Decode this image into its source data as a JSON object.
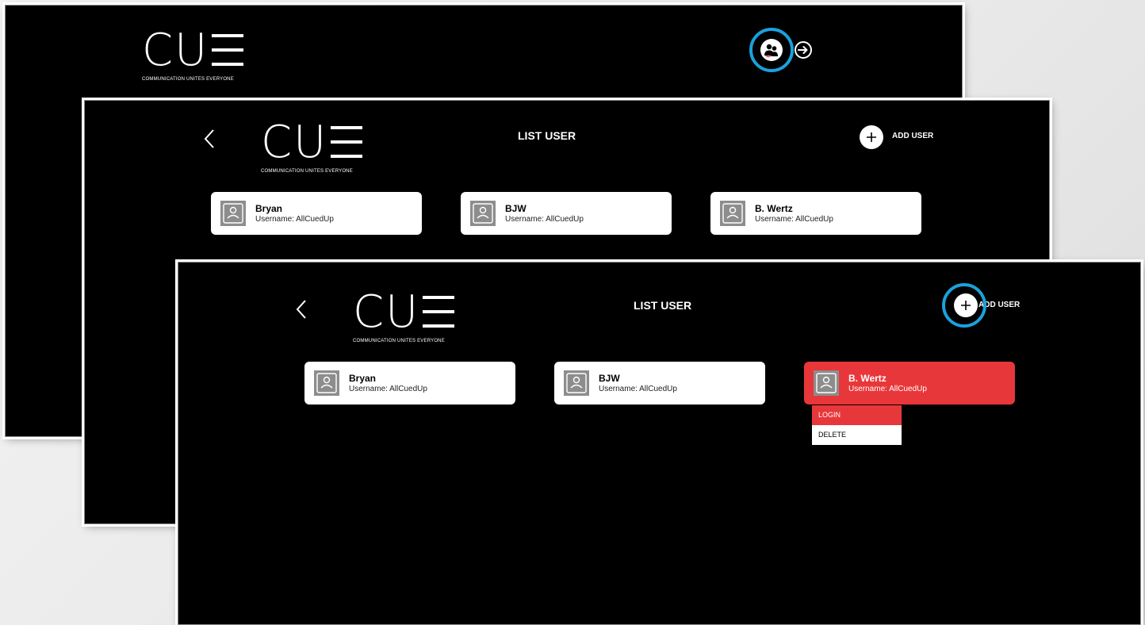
{
  "brand": {
    "logo_text": "CU",
    "tagline": "COMMUNICATION UNITES EVERYONE"
  },
  "home_screen": {
    "icons": [
      "users-icon",
      "login-icon"
    ]
  },
  "list_screen": {
    "title": "LIST USER",
    "add_user_label": "ADD USER",
    "back_icon": "chevron-left-icon",
    "avatar_label": "ACCOUNT",
    "users": [
      {
        "name": "Bryan",
        "username": "Username: AllCuedUp"
      },
      {
        "name": "BJW",
        "username": "Username: AllCuedUp"
      },
      {
        "name": "B. Wertz",
        "username": "Username: AllCuedUp"
      }
    ]
  },
  "context_menu": {
    "items": [
      "LOGIN",
      "DELETE"
    ]
  },
  "colors": {
    "background": "#000000",
    "accent_red": "#e8373a",
    "highlight_blue": "#1aa1dd",
    "card": "#ffffff",
    "avatar": "#8d8d8d"
  }
}
